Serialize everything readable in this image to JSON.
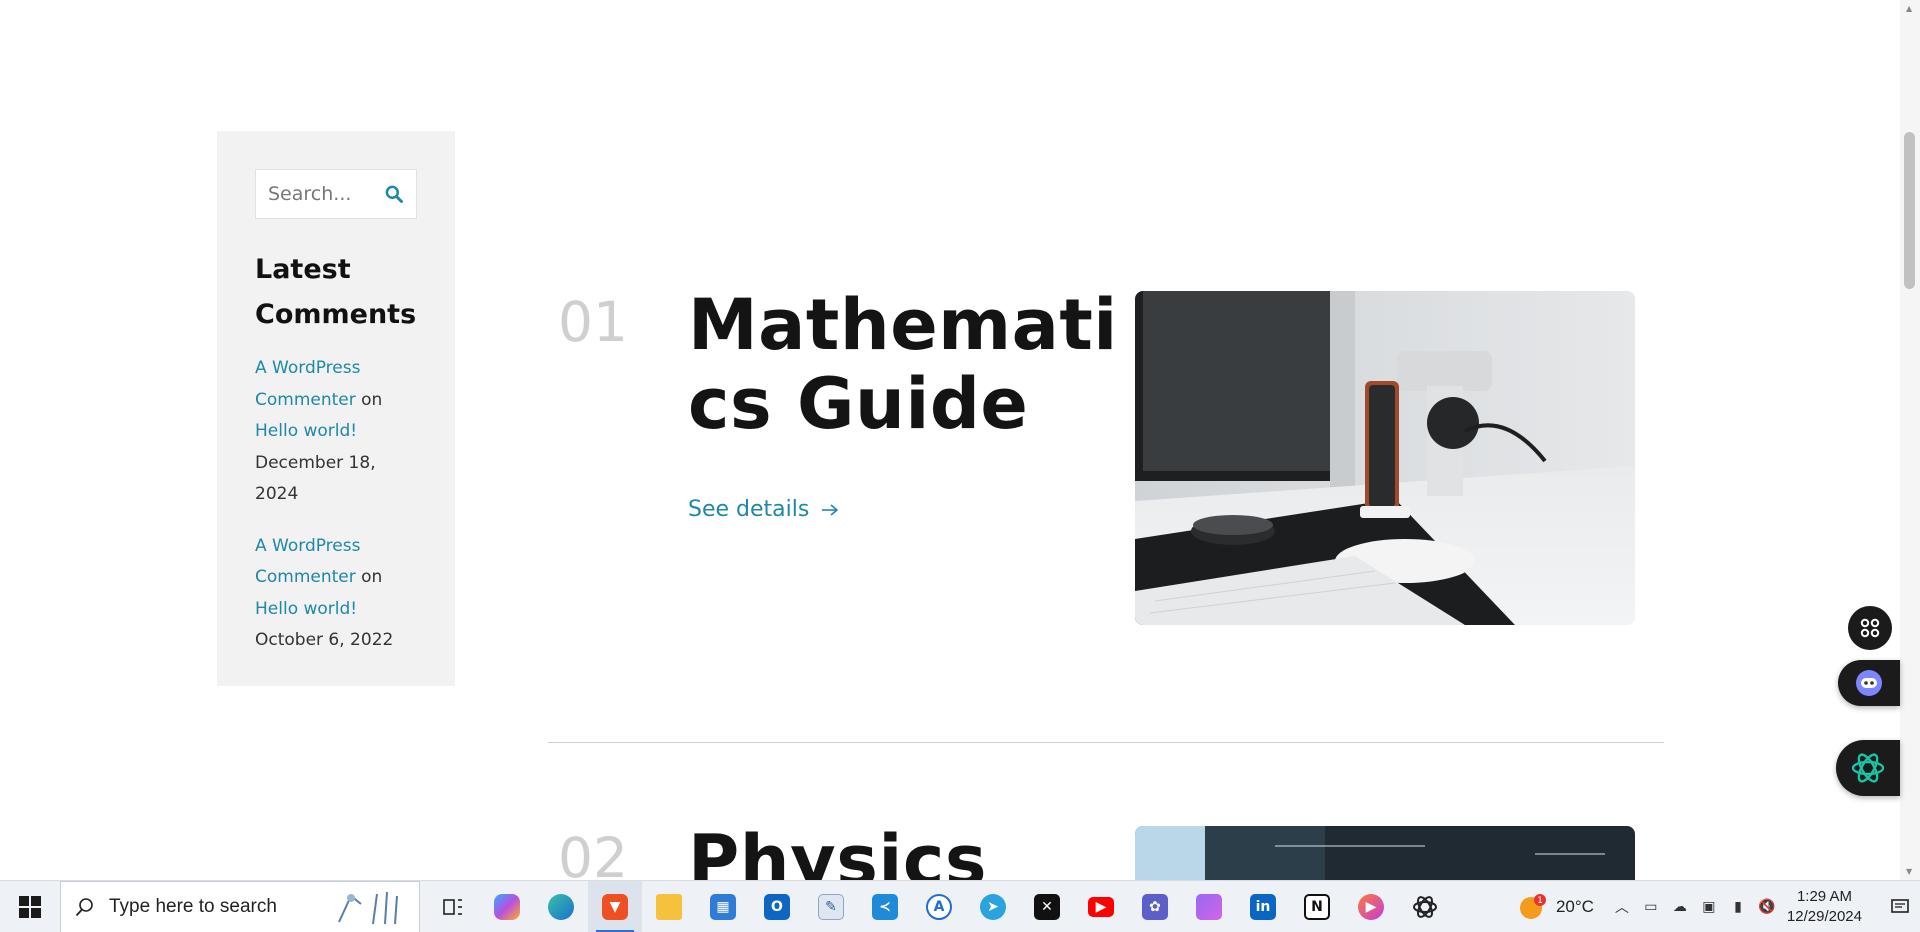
{
  "sidebar": {
    "search_placeholder": "Search...",
    "widget_title": "Latest Comments",
    "comments": [
      {
        "author": "A WordPress Commenter",
        "connector": " on ",
        "post": "Hello world!",
        "date": "December 18, 2024"
      },
      {
        "author": "A WordPress Commenter",
        "connector": " on ",
        "post": "Hello world!",
        "date": "October 6, 2022"
      }
    ]
  },
  "items": [
    {
      "number": "01",
      "title_line1": "Mathemati",
      "title_line2": "cs Guide",
      "link": "See details"
    },
    {
      "number": "02",
      "title_line1": "Physics"
    }
  ],
  "colors": {
    "accent": "#1e88a8",
    "number": "#cfcfcf",
    "sidebar_bg": "#f2f2f3"
  },
  "floating_buttons": [
    "apps-grid-icon",
    "chat-bot-icon",
    "ai-assistant-icon"
  ],
  "taskbar": {
    "search_placeholder": "Type here to search",
    "apps": [
      "task-view-icon",
      "copilot-icon",
      "edge-icon",
      "brave-icon",
      "file-explorer-icon",
      "microsoft-store-icon",
      "outlook-icon",
      "file-tool-icon",
      "vscode-icon",
      "app-a-icon",
      "telegram-icon",
      "capcut-icon",
      "youtube-icon",
      "gallery-icon",
      "folder-icon",
      "linkedin-icon",
      "notion-icon",
      "media-player-icon",
      "chatgpt-icon"
    ],
    "weather": {
      "temperature": "20°C",
      "badge": "1"
    },
    "clock": {
      "time": "1:29 AM",
      "date": "12/29/2024"
    }
  }
}
